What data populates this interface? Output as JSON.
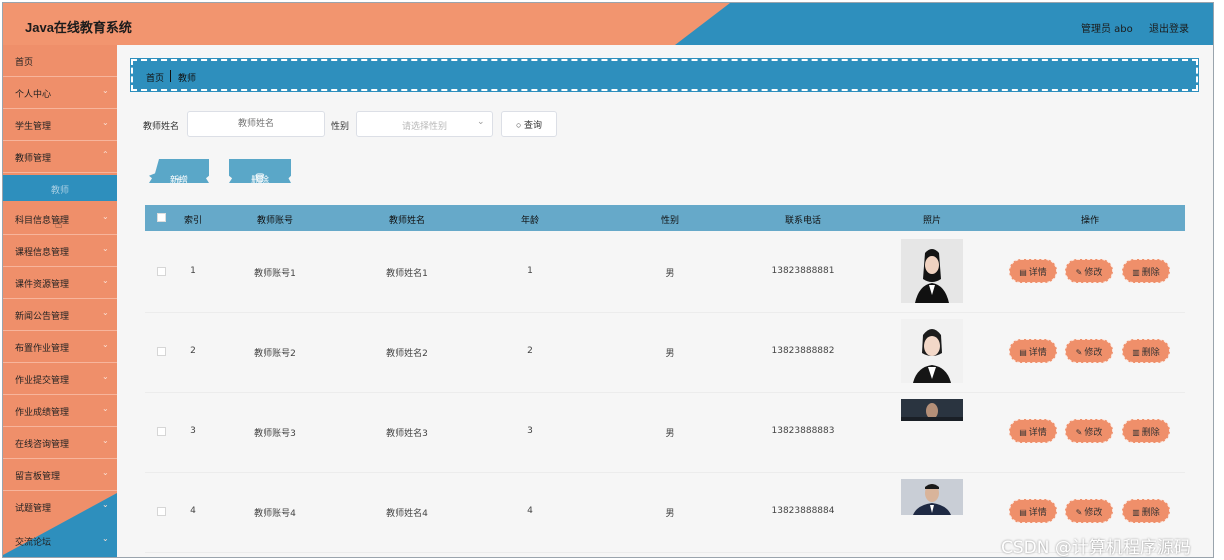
{
  "header": {
    "title": "Java在线教育系统",
    "admin_label": "管理员 abo",
    "logout_label": "退出登录"
  },
  "sidebar": {
    "items": [
      {
        "label": "首页",
        "has_chevron": false
      },
      {
        "label": "个人中心",
        "has_chevron": true
      },
      {
        "label": "学生管理",
        "has_chevron": true
      },
      {
        "label": "教师管理",
        "has_chevron": true
      },
      {
        "label": "科目信息管理",
        "has_chevron": true
      },
      {
        "label": "课程信息管理",
        "has_chevron": true
      },
      {
        "label": "课件资源管理",
        "has_chevron": true
      },
      {
        "label": "新闻公告管理",
        "has_chevron": true
      },
      {
        "label": "布置作业管理",
        "has_chevron": true
      },
      {
        "label": "作业提交管理",
        "has_chevron": true
      },
      {
        "label": "作业成绩管理",
        "has_chevron": true
      },
      {
        "label": "在线咨询管理",
        "has_chevron": true
      },
      {
        "label": "留言板管理",
        "has_chevron": true
      },
      {
        "label": "试题管理",
        "has_chevron": true
      },
      {
        "label": "交流论坛",
        "has_chevron": true
      }
    ],
    "active_sub": "教师"
  },
  "breadcrumb": {
    "home": "首页",
    "current": "教师"
  },
  "search": {
    "name_label": "教师姓名",
    "name_placeholder": "教师姓名",
    "gender_label": "性别",
    "gender_placeholder": "请选择性别",
    "query_label": "查询"
  },
  "actions": {
    "add_label": "新增",
    "delete_label": "删除"
  },
  "table": {
    "columns": [
      "索引",
      "教师账号",
      "教师姓名",
      "年龄",
      "性别",
      "联系电话",
      "照片",
      "操作"
    ],
    "rows": [
      {
        "index": "1",
        "account": "教师账号1",
        "name": "教师姓名1",
        "age": "1",
        "gender": "男",
        "phone": "13823888881"
      },
      {
        "index": "2",
        "account": "教师账号2",
        "name": "教师姓名2",
        "age": "2",
        "gender": "男",
        "phone": "13823888882"
      },
      {
        "index": "3",
        "account": "教师账号3",
        "name": "教师姓名3",
        "age": "3",
        "gender": "男",
        "phone": "13823888883"
      },
      {
        "index": "4",
        "account": "教师账号4",
        "name": "教师姓名4",
        "age": "4",
        "gender": "男",
        "phone": "13823888884"
      }
    ],
    "op_labels": {
      "detail": "详情",
      "edit": "修改",
      "delete": "删除"
    }
  },
  "watermark": "CSDN @计算机程序源码",
  "colors": {
    "accent_orange": "#ef8f6a",
    "accent_blue": "#2e8fbd",
    "table_header": "#66a9c9"
  }
}
